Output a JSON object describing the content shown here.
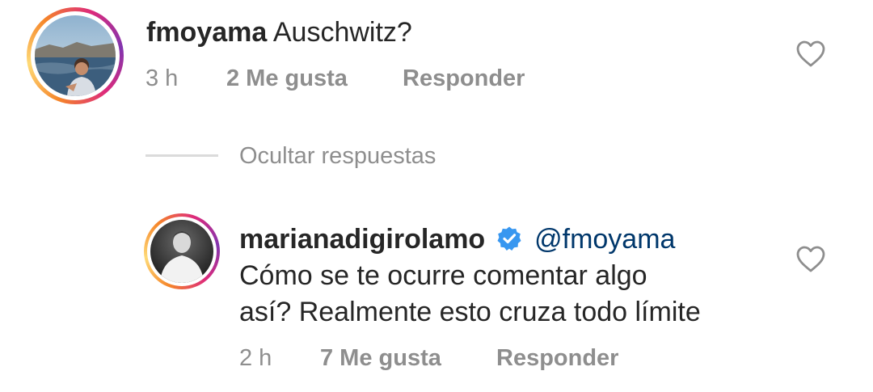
{
  "comment": {
    "username": "fmoyama",
    "text": "Auschwitz?",
    "time": "3 h",
    "likes": "2 Me gusta",
    "reply": "Responder",
    "like_icon": "heart-outline-icon"
  },
  "replies_toggle": {
    "label": "Ocultar respuestas"
  },
  "reply_comment": {
    "username": "marianadigirolamo",
    "verified_icon": "verified-badge-icon",
    "verified_color": "#3897f0",
    "mention": "@fmoyama",
    "text_line1": "Cómo se te ocurre comentar algo",
    "text_line2": "así? Realmente esto cruza todo límite",
    "time": "2 h",
    "likes": "7 Me gusta",
    "reply": "Responder",
    "like_icon": "heart-outline-icon"
  },
  "colors": {
    "text": "#262626",
    "meta": "#8e8e8e",
    "mention": "#00376b",
    "divider": "#dbdbdb"
  }
}
